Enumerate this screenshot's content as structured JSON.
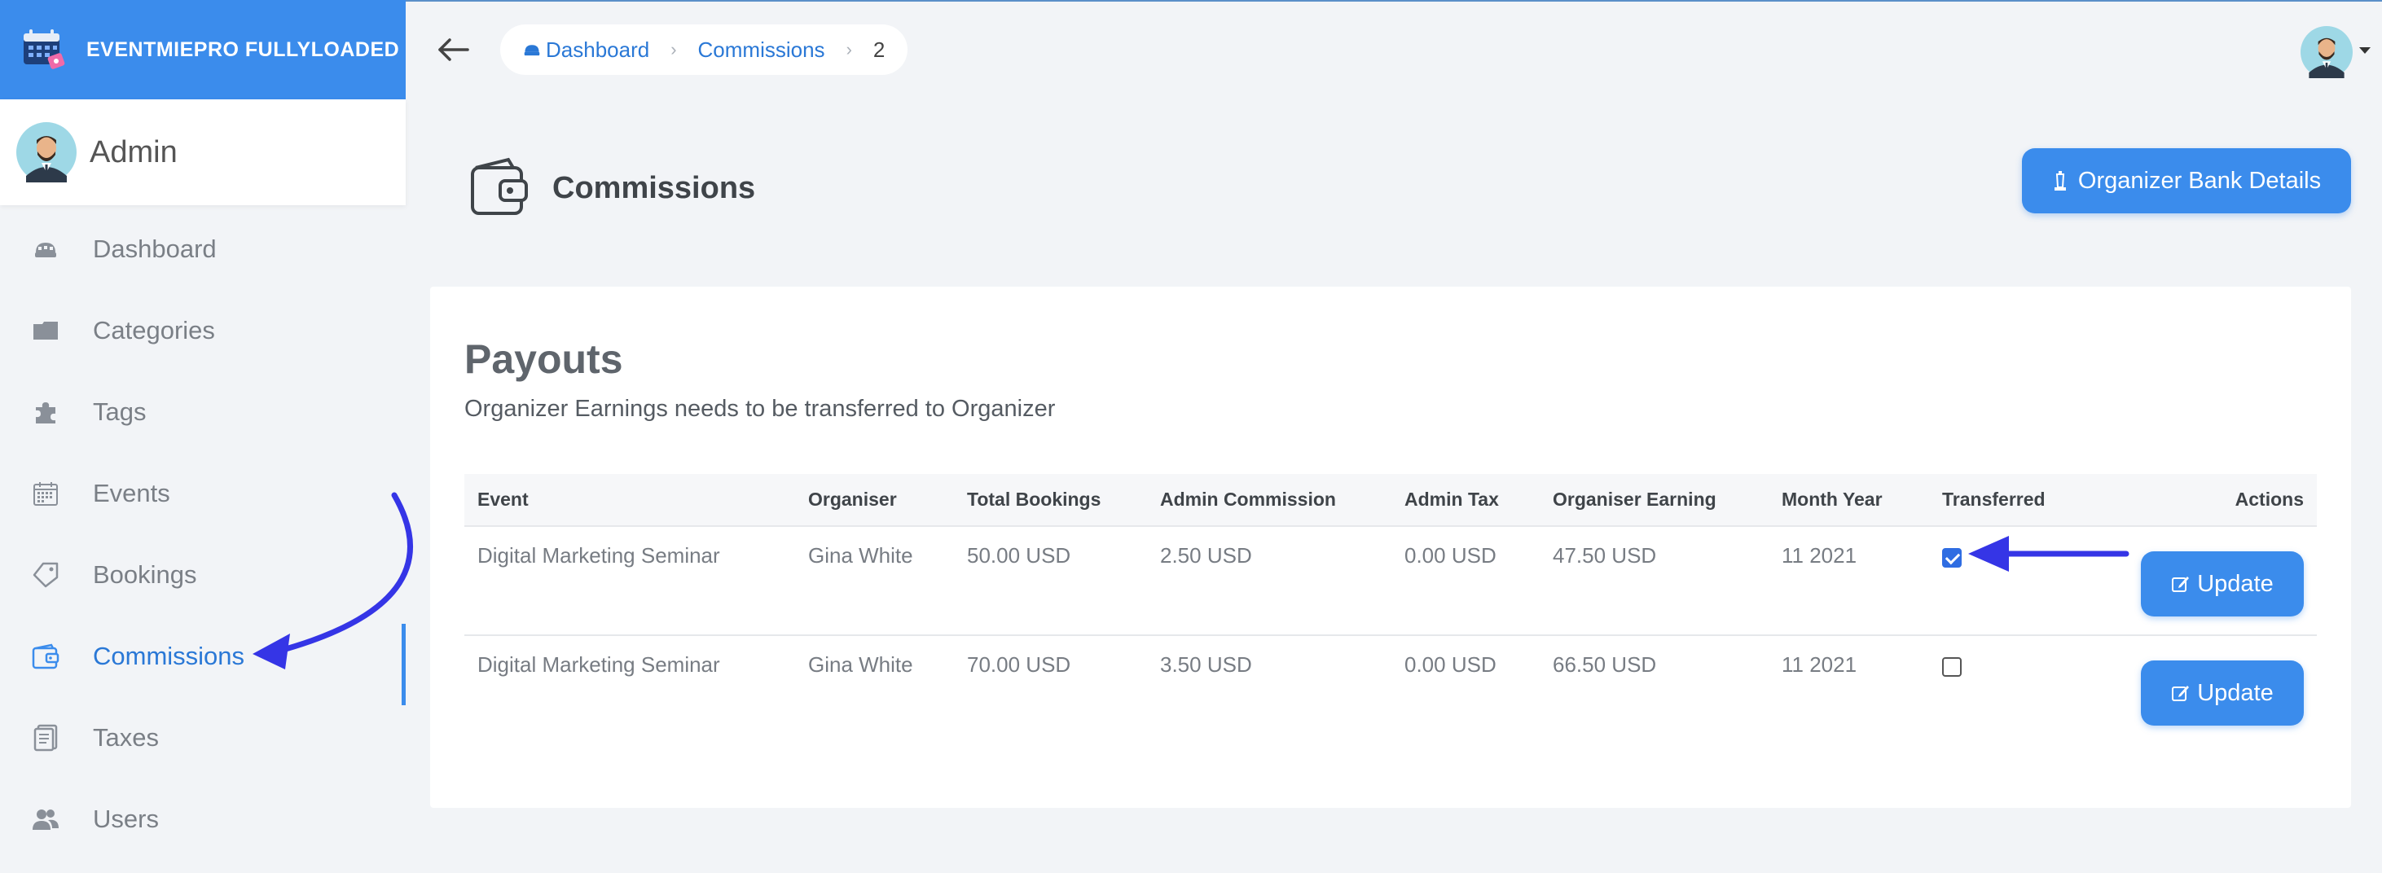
{
  "app": {
    "brand": "EVENTMIEPRO FULLYLOADED",
    "user_role": "Admin"
  },
  "sidebar": {
    "items": [
      {
        "label": "Dashboard",
        "icon": "dashboard-icon"
      },
      {
        "label": "Categories",
        "icon": "folder-icon"
      },
      {
        "label": "Tags",
        "icon": "puzzle-icon"
      },
      {
        "label": "Events",
        "icon": "calendar-icon"
      },
      {
        "label": "Bookings",
        "icon": "ticket-icon"
      },
      {
        "label": "Commissions",
        "icon": "wallet-icon",
        "active": true
      },
      {
        "label": "Taxes",
        "icon": "document-icon"
      },
      {
        "label": "Users",
        "icon": "users-icon"
      }
    ]
  },
  "breadcrumb": {
    "home": "Dashboard",
    "section": "Commissions",
    "current": "2"
  },
  "page": {
    "title": "Commissions",
    "bank_button": "Organizer Bank Details"
  },
  "payouts": {
    "title": "Payouts",
    "subtitle": "Organizer Earnings needs to be transferred to Organizer",
    "columns": [
      "Event",
      "Organiser",
      "Total Bookings",
      "Admin Commission",
      "Admin Tax",
      "Organiser Earning",
      "Month Year",
      "Transferred",
      "Actions"
    ],
    "rows": [
      {
        "event": "Digital Marketing Seminar",
        "organiser": "Gina White",
        "total_bookings": "50.00 USD",
        "admin_commission": "2.50 USD",
        "admin_tax": "0.00 USD",
        "organiser_earning": "47.50 USD",
        "month_year": "11 2021",
        "transferred": true,
        "action": "Update"
      },
      {
        "event": "Digital Marketing Seminar",
        "organiser": "Gina White",
        "total_bookings": "70.00 USD",
        "admin_commission": "3.50 USD",
        "admin_tax": "0.00 USD",
        "organiser_earning": "66.50 USD",
        "month_year": "11 2021",
        "transferred": false,
        "action": "Update"
      }
    ]
  },
  "colors": {
    "brand": "#3b8cec",
    "active": "#2a78d6",
    "annotation_arrow": "#3535e6"
  }
}
